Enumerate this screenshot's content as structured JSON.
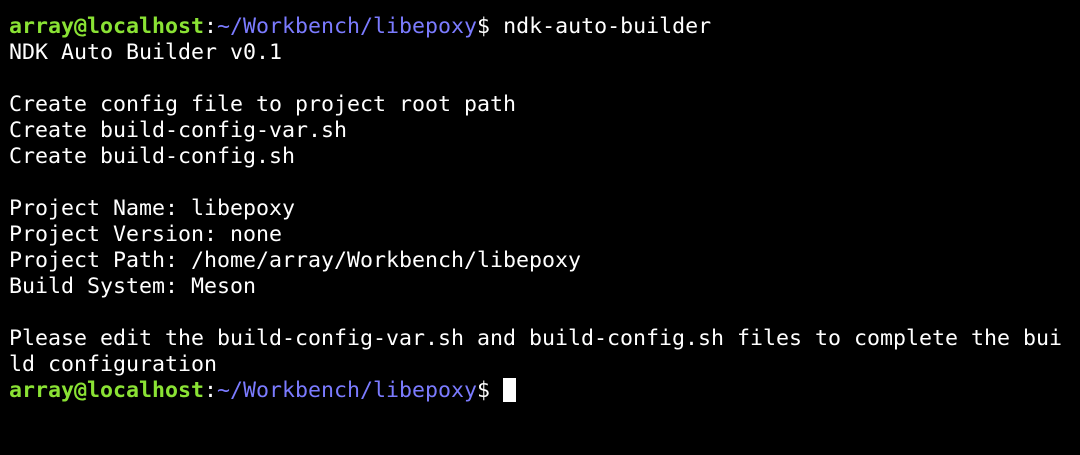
{
  "prompt": {
    "user_host": "array@localhost",
    "separator": ":",
    "path": "~/Workbench/libepoxy",
    "symbol": "$"
  },
  "command": " ndk-auto-builder",
  "output": [
    "NDK Auto Builder v0.1",
    "",
    "Create config file to project root path",
    "Create build-config-var.sh",
    "Create build-config.sh",
    "",
    "Project Name: libepoxy",
    "Project Version: none",
    "Project Path: /home/array/Workbench/libepoxy",
    "Build System: Meson",
    "",
    "Please edit the build-config-var.sh and build-config.sh files to complete the bui",
    "ld configuration"
  ],
  "colors": {
    "background": "#000000",
    "user_host": "#8ae234",
    "path": "#7b7bff",
    "text": "#ffffff"
  }
}
